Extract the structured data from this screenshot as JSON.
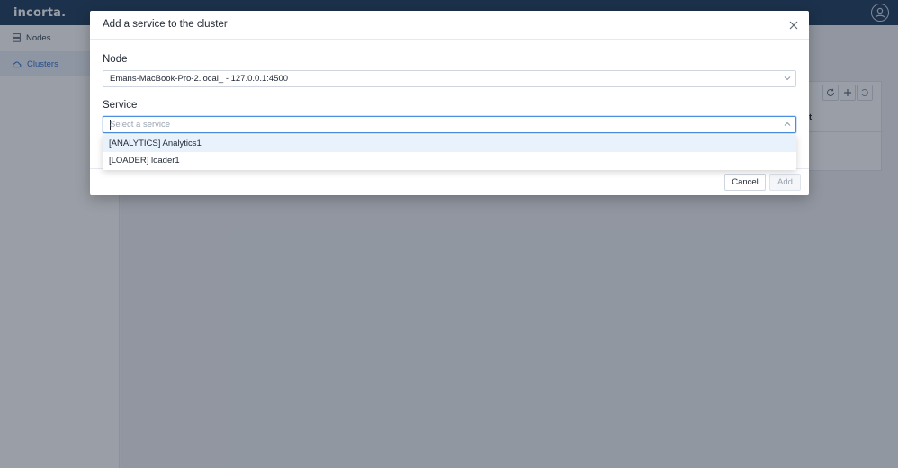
{
  "app": {
    "logo": "incorta."
  },
  "sidebar": {
    "items": [
      {
        "label": "Nodes",
        "icon": "server-icon",
        "active": false
      },
      {
        "label": "Clusters",
        "icon": "cloud-icon",
        "active": true
      }
    ]
  },
  "background_card": {
    "header_fragment": "t"
  },
  "modal": {
    "title": "Add a service to the cluster",
    "node_label": "Node",
    "node_value": "Emans-MacBook-Pro-2.local_ - 127.0.0.1:4500",
    "service_label": "Service",
    "service_placeholder": "Select a service",
    "service_options": [
      "[ANALYTICS] Analytics1",
      "[LOADER] loader1"
    ],
    "cancel_label": "Cancel",
    "add_label": "Add"
  },
  "colors": {
    "topbar": "#1a3a5a",
    "accent": "#2d6ec9",
    "focus_border": "#4a8fe0",
    "option_hover": "#e8f2fc"
  }
}
